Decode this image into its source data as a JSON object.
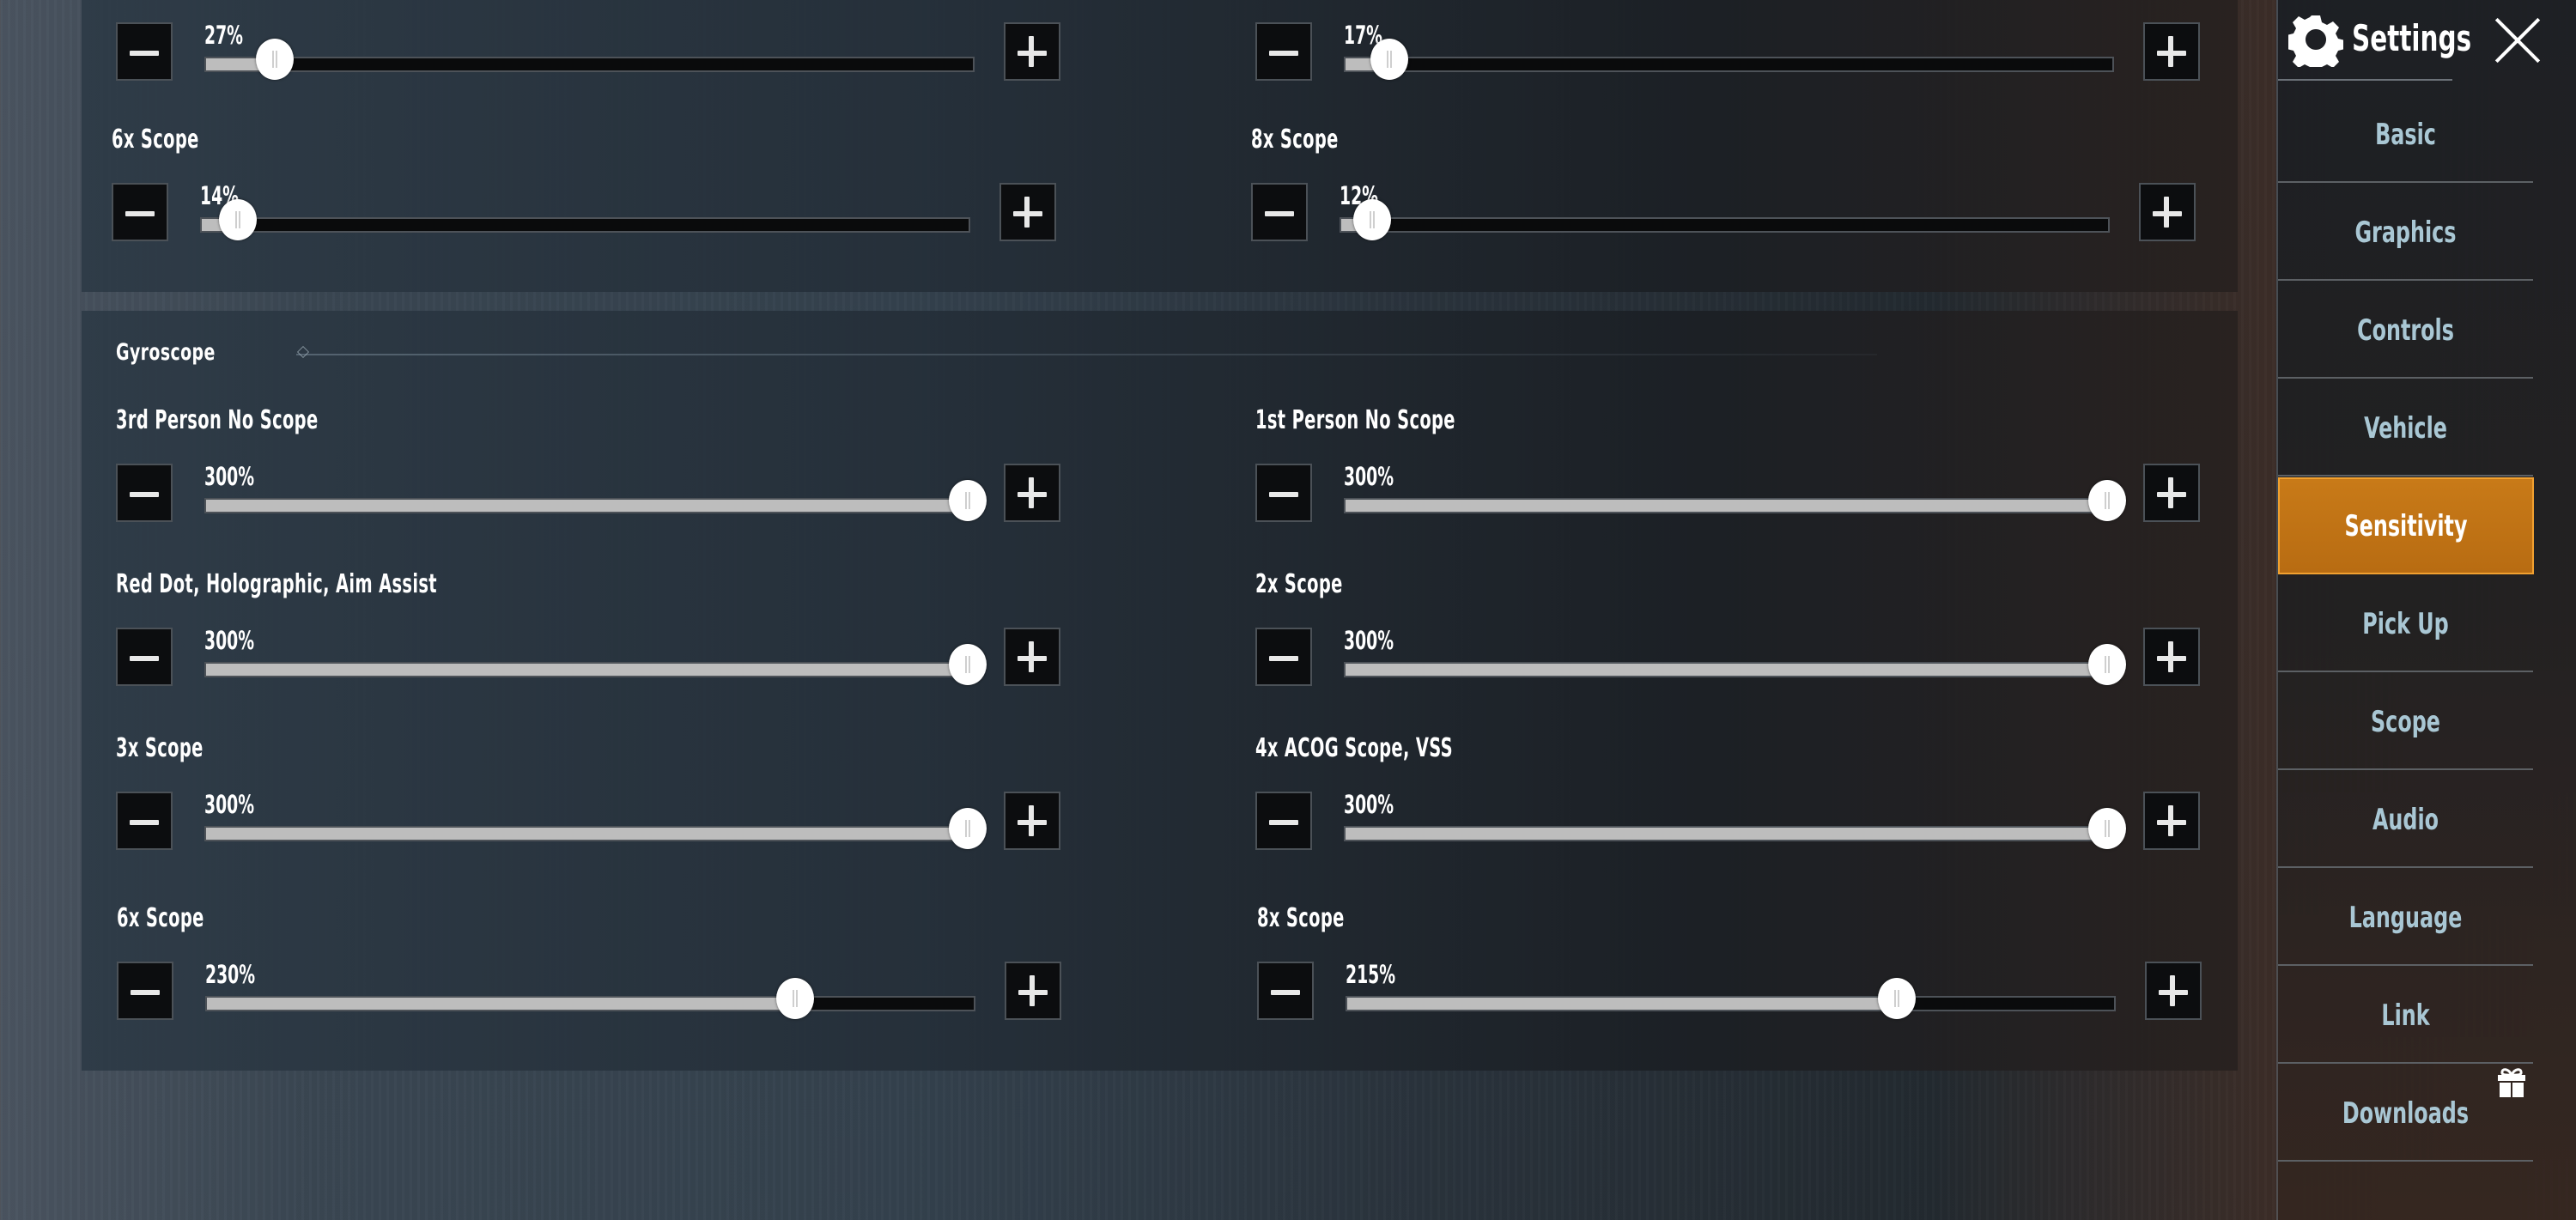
{
  "header": {
    "title": "Settings",
    "close_label": "Close"
  },
  "sidebar": {
    "items": [
      {
        "label": "Basic",
        "active": false
      },
      {
        "label": "Graphics",
        "active": false
      },
      {
        "label": "Controls",
        "active": false
      },
      {
        "label": "Vehicle",
        "active": false
      },
      {
        "label": "Sensitivity",
        "active": true
      },
      {
        "label": "Pick Up",
        "active": false
      },
      {
        "label": "Scope",
        "active": false
      },
      {
        "label": "Audio",
        "active": false
      },
      {
        "label": "Language",
        "active": false
      },
      {
        "label": "Link",
        "active": false
      },
      {
        "label": "Downloads",
        "active": false,
        "badge_icon": "gift-icon"
      }
    ]
  },
  "slider_range": {
    "min": 0,
    "max": 300
  },
  "scope_panel": {
    "settings": [
      {
        "label": "",
        "value": 27,
        "display": "27%"
      },
      {
        "label": "",
        "value": 17,
        "display": "17%"
      },
      {
        "label": "6x Scope",
        "value": 14,
        "display": "14%"
      },
      {
        "label": "8x Scope",
        "value": 12,
        "display": "12%"
      }
    ]
  },
  "gyroscope": {
    "title": "Gyroscope",
    "settings": [
      {
        "label": "3rd Person No Scope",
        "value": 300,
        "display": "300%"
      },
      {
        "label": "1st Person No Scope",
        "value": 300,
        "display": "300%"
      },
      {
        "label": "Red Dot, Holographic, Aim Assist",
        "value": 300,
        "display": "300%"
      },
      {
        "label": "2x Scope",
        "value": 300,
        "display": "300%"
      },
      {
        "label": "3x Scope",
        "value": 300,
        "display": "300%"
      },
      {
        "label": "4x ACOG Scope, VSS",
        "value": 300,
        "display": "300%"
      },
      {
        "label": "6x Scope",
        "value": 230,
        "display": "230%"
      },
      {
        "label": "8x Scope",
        "value": 215,
        "display": "215%"
      }
    ]
  },
  "colors": {
    "accent": "#c87a18",
    "nav_text": "#a9c7d4",
    "fill": "#bdbdbd"
  }
}
